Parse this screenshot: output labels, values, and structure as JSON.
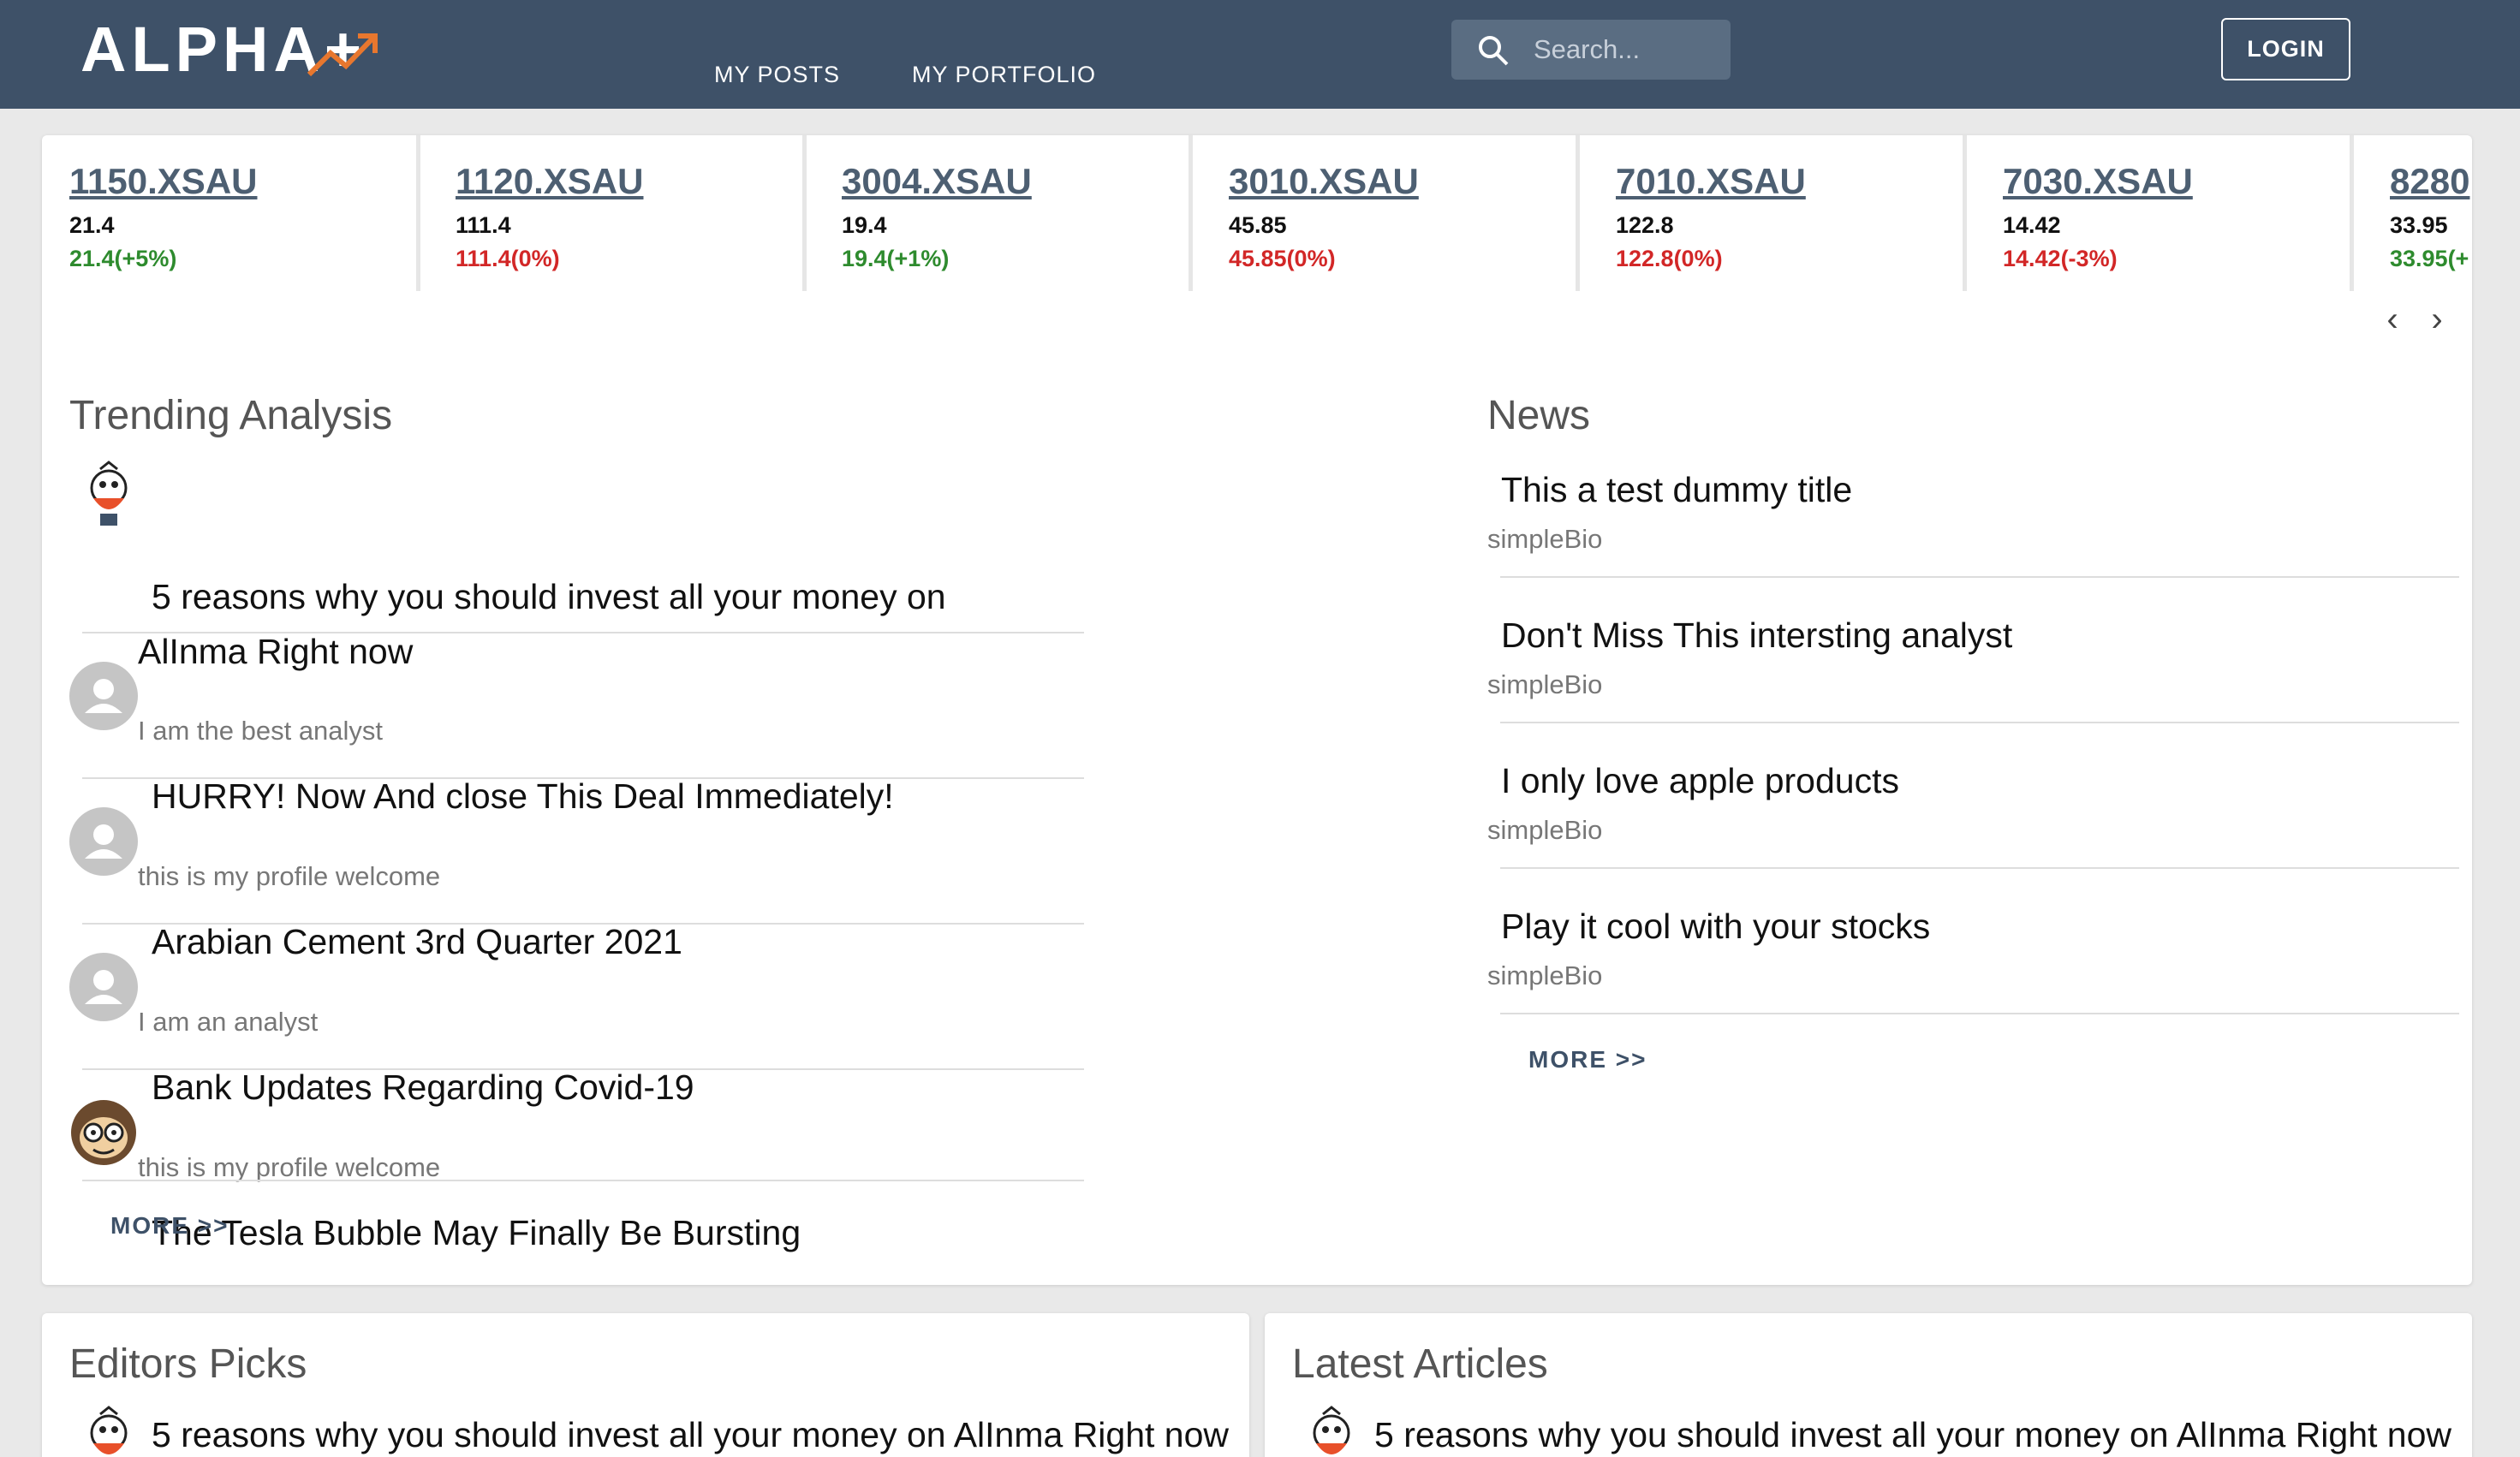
{
  "header": {
    "logo_text": "ALPHA+",
    "nav": [
      "MY POSTS",
      "MY PORTFOLIO"
    ],
    "search_placeholder": "Search...",
    "login_label": "LOGIN"
  },
  "tickers": [
    {
      "symbol": "1150.XSAU",
      "price": "21.4",
      "change": "21.4(+5%)",
      "direction": "up"
    },
    {
      "symbol": "1120.XSAU",
      "price": "111.4",
      "change": "111.4(0%)",
      "direction": "down"
    },
    {
      "symbol": "3004.XSAU",
      "price": "19.4",
      "change": "19.4(+1%)",
      "direction": "up"
    },
    {
      "symbol": "3010.XSAU",
      "price": "45.85",
      "change": "45.85(0%)",
      "direction": "down"
    },
    {
      "symbol": "7010.XSAU",
      "price": "122.8",
      "change": "122.8(0%)",
      "direction": "down"
    },
    {
      "symbol": "7030.XSAU",
      "price": "14.42",
      "change": "14.42(-3%)",
      "direction": "down"
    },
    {
      "symbol": "8280",
      "price": "33.95",
      "change": "33.95(+",
      "direction": "up"
    }
  ],
  "carousel": {
    "prev": "‹",
    "next": "›"
  },
  "trending": {
    "title": "Trending Analysis",
    "items": [
      {
        "title_line1": "5 reasons why you should invest all your money on",
        "title_line2": "AlInma Right now",
        "subtitle": "I am the best analyst",
        "avatar": "cartoon-bird-avatar"
      },
      {
        "title_line1": "HURRY! Now And close This Deal Immediately!",
        "subtitle": "this is my profile welcome",
        "avatar": "default-user-avatar"
      },
      {
        "title_line1": "Arabian Cement 3rd Quarter 2021",
        "subtitle": "I am an analyst",
        "avatar": "default-user-avatar"
      },
      {
        "title_line1": "Bank Updates Regarding Covid-19",
        "subtitle": "this is my profile welcome",
        "avatar": "default-user-avatar"
      },
      {
        "title_line1": "The Tesla Bubble May Finally Be Bursting",
        "subtitle": "",
        "avatar": "cartoon-monkey-avatar"
      }
    ],
    "more": "MORE >>"
  },
  "news": {
    "title": "News",
    "items": [
      {
        "title": "This a test dummy title",
        "subtitle": "simpleBio"
      },
      {
        "title": "Don't Miss This intersting analyst",
        "subtitle": "simpleBio"
      },
      {
        "title": "I only love apple products",
        "subtitle": "simpleBio"
      },
      {
        "title": "Play it cool with your stocks",
        "subtitle": "simpleBio"
      }
    ],
    "more": "MORE >>"
  },
  "editors_picks": {
    "title": "Editors Picks",
    "first_item": "5 reasons why you should invest all your money on AlInma Right now"
  },
  "latest_articles": {
    "title": "Latest Articles",
    "first_item": "5 reasons why you should invest all your money on AlInma Right now"
  },
  "colors": {
    "header_bg": "#3e5168",
    "logo_accent": "#e8772e",
    "up": "#2e8b2e",
    "down": "#d22727",
    "link": "#4d5f72"
  }
}
